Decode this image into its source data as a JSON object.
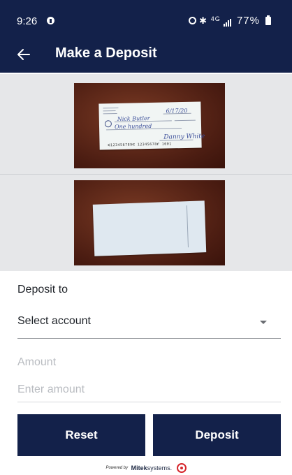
{
  "status_bar": {
    "time": "9:26",
    "network_label": "4G",
    "battery_percent": "77%"
  },
  "app_bar": {
    "title": "Make a Deposit",
    "back_icon": "arrow-left-icon"
  },
  "check_images": {
    "front": {
      "description": "check-front-photo"
    },
    "back": {
      "description": "check-back-photo"
    }
  },
  "form": {
    "deposit_to_label": "Deposit to",
    "account_select": {
      "value": "Select account",
      "icon": "caret-down-icon"
    },
    "amount_label": "Amount",
    "amount_input": {
      "value": "",
      "placeholder": "Enter amount"
    }
  },
  "buttons": {
    "reset_label": "Reset",
    "deposit_label": "Deposit"
  },
  "footer": {
    "powered_by": "Powered by",
    "brand_name": "Mitek",
    "brand_suffix": "systems."
  },
  "colors": {
    "primary_navy": "#13214a",
    "image_background": "#e6e7e9",
    "brand_red": "#d6262c"
  }
}
